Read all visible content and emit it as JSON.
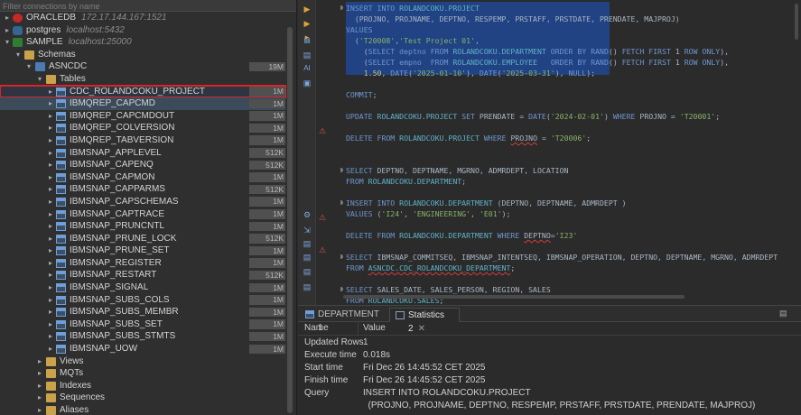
{
  "navigator": {
    "filter_placeholder": "Filter connections by name",
    "connections": [
      {
        "name": "ORACLEDB",
        "host": "172.17.144.167:1521"
      },
      {
        "name": "postgres",
        "host": "localhost:5432"
      },
      {
        "name": "SAMPLE",
        "host": "localhost:25000"
      }
    ],
    "schemas_label": "Schemas",
    "schema_name": "ASNCDC",
    "schema_size": "19M",
    "tables_label": "Tables",
    "tables": [
      {
        "name": "CDC_ROLANDCOKU_PROJECT",
        "size": "1M"
      },
      {
        "name": "IBMQREP_CAPCMD",
        "size": "1M"
      },
      {
        "name": "IBMQREP_CAPCMDOUT",
        "size": "1M"
      },
      {
        "name": "IBMQREP_COLVERSION",
        "size": "1M"
      },
      {
        "name": "IBMQREP_TABVERSION",
        "size": "1M"
      },
      {
        "name": "IBMSNAP_APPLEVEL",
        "size": "512K"
      },
      {
        "name": "IBMSNAP_CAPENQ",
        "size": "512K"
      },
      {
        "name": "IBMSNAP_CAPMON",
        "size": "1M"
      },
      {
        "name": "IBMSNAP_CAPPARMS",
        "size": "512K"
      },
      {
        "name": "IBMSNAP_CAPSCHEMAS",
        "size": "1M"
      },
      {
        "name": "IBMSNAP_CAPTRACE",
        "size": "1M"
      },
      {
        "name": "IBMSNAP_PRUNCNTL",
        "size": "1M"
      },
      {
        "name": "IBMSNAP_PRUNE_LOCK",
        "size": "512K"
      },
      {
        "name": "IBMSNAP_PRUNE_SET",
        "size": "1M"
      },
      {
        "name": "IBMSNAP_REGISTER",
        "size": "1M"
      },
      {
        "name": "IBMSNAP_RESTART",
        "size": "512K"
      },
      {
        "name": "IBMSNAP_SIGNAL",
        "size": "1M"
      },
      {
        "name": "IBMSNAP_SUBS_COLS",
        "size": "1M"
      },
      {
        "name": "IBMSNAP_SUBS_MEMBR",
        "size": "1M"
      },
      {
        "name": "IBMSNAP_SUBS_SET",
        "size": "1M"
      },
      {
        "name": "IBMSNAP_SUBS_STMTS",
        "size": "1M"
      },
      {
        "name": "IBMSNAP_UOW",
        "size": "1M"
      }
    ],
    "folders": [
      "Views",
      "MQTs",
      "Indexes",
      "Sequences",
      "Aliases"
    ]
  },
  "editor": {
    "lines": [
      "INSERT INTO ROLANDCOKU.PROJECT",
      "  (PROJNO, PROJNAME, DEPTNO, RESPEMP, PRSTAFF, PRSTDATE, PRENDATE, MAJPROJ)",
      "VALUES",
      "  ('T20008','Test Project 01',",
      "    (SELECT deptno FROM ROLANDCOKU.DEPARTMENT ORDER BY RAND() FETCH FIRST 1 ROW ONLY),",
      "    (SELECT empno  FROM ROLANDCOKU.EMPLOYEE   ORDER BY RAND() FETCH FIRST 1 ROW ONLY),",
      "    1.50, DATE('2025-01-10'), DATE('2025-03-31'), NULL);",
      "",
      "COMMIT;",
      "",
      "UPDATE ROLANDCOKU.PROJECT SET PRENDATE = DATE('2024-02-01') WHERE PROJNO = 'T20001';",
      "",
      "DELETE FROM ROLANDCOKU.PROJECT WHERE PROJNO = 'T20006';",
      "",
      "",
      "SELECT DEPTNO, DEPTNAME, MGRNO, ADMRDEPT, LOCATION",
      "FROM ROLANDCOKU.DEPARTMENT;",
      "",
      "INSERT INTO ROLANDCOKU.DEPARTMENT (DEPTNO, DEPTNAME, ADMRDEPT )",
      "VALUES ('I24', 'ENGINEERING', 'E01');",
      "",
      "DELETE FROM ROLANDCOKU.DEPARTMENT WHERE DEPTNO='I23'",
      "",
      "SELECT IBMSNAP_COMMITSEQ, IBMSNAP_INTENTSEQ, IBMSNAP_OPERATION, DEPTNO, DEPTNAME, MGRNO, ADMRDEPT",
      "FROM ASNCDC.CDC_ROLANDCOKU_DEPARTMENT;",
      "",
      "SELECT SALES_DATE, SALES_PERSON, REGION, SALES",
      "FROM ROLANDCOKU.SALES;"
    ]
  },
  "results": {
    "tabs": [
      {
        "label": "DEPARTMENT 1"
      },
      {
        "label": "Statistics 2"
      }
    ],
    "columns": [
      "Name",
      "Value"
    ],
    "rows": [
      {
        "name": "Updated Rows",
        "value": "1"
      },
      {
        "name": "Execute time",
        "value": "0.018s"
      },
      {
        "name": "Start time",
        "value": "Fri Dec 26 14:45:52 CET 2025"
      },
      {
        "name": "Finish time",
        "value": "Fri Dec 26 14:45:52 CET 2025"
      },
      {
        "name": "Query",
        "value": "INSERT INTO ROLANDCOKU.PROJECT"
      },
      {
        "name": "",
        "value": "  (PROJNO, PROJNAME, DEPTNO, RESPEMP, PRSTAFF, PRSTDATE, PRENDATE, MAJPROJ)"
      }
    ]
  },
  "colors": {
    "highlight_box": "#d9252a",
    "selection": "#214283",
    "keyword": "#6f97d0",
    "string": "#88b36a"
  }
}
